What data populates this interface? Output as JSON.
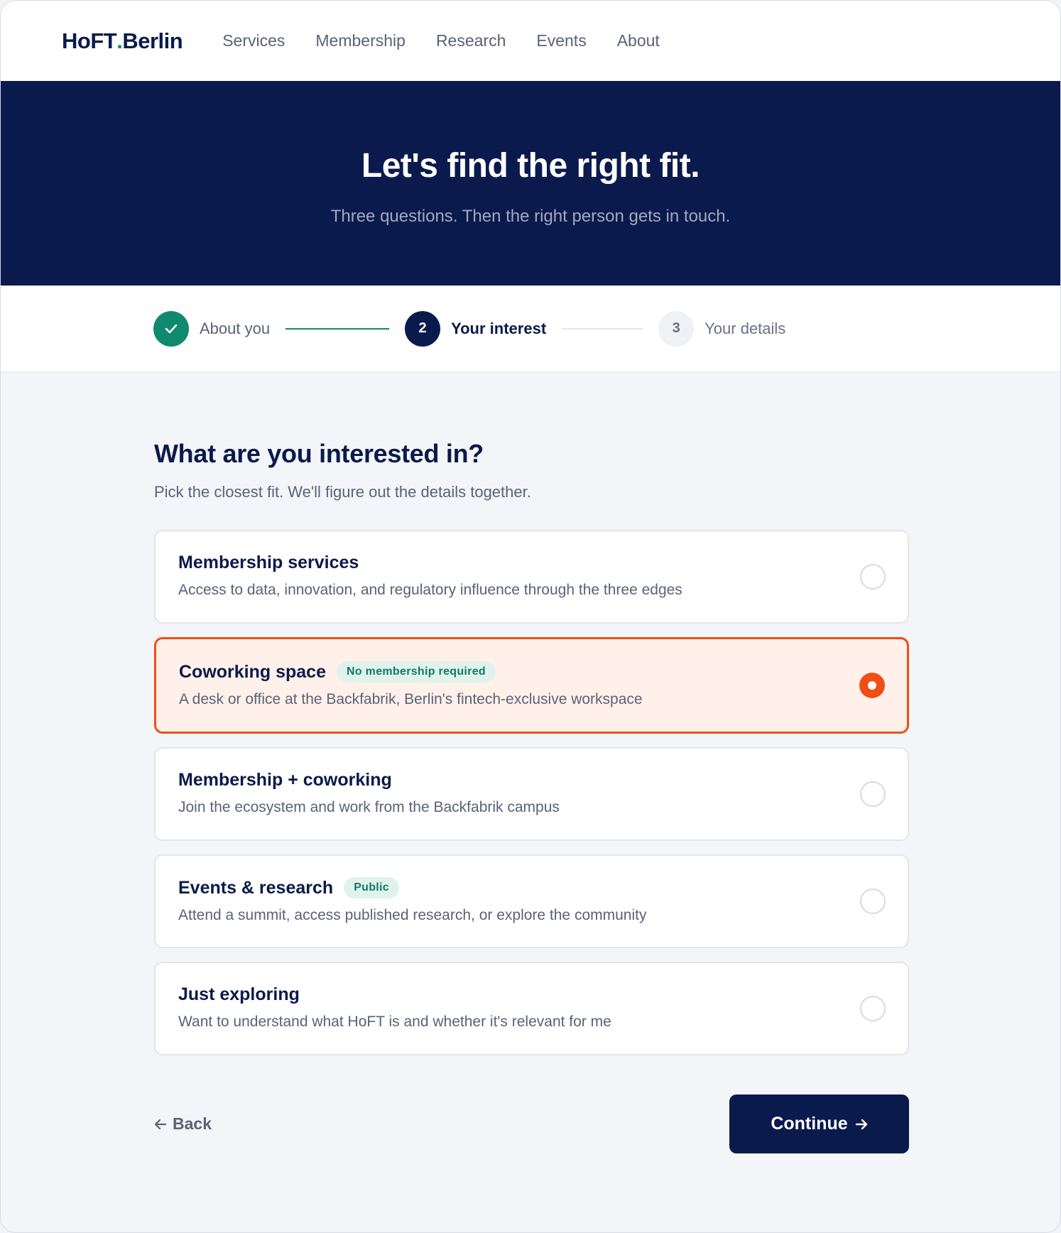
{
  "header": {
    "logo_main": "HoFT",
    "logo_dot": ".",
    "logo_suffix": "Berlin",
    "nav": [
      "Services",
      "Membership",
      "Research",
      "Events",
      "About"
    ]
  },
  "hero": {
    "title": "Let's find the right fit.",
    "subtitle": "Three questions. Then the right person gets in touch."
  },
  "stepper": {
    "steps": [
      {
        "number": "1",
        "label": "About you",
        "state": "done"
      },
      {
        "number": "2",
        "label": "Your interest",
        "state": "active"
      },
      {
        "number": "3",
        "label": "Your details",
        "state": "todo"
      }
    ]
  },
  "question": {
    "title": "What are you interested in?",
    "subtitle": "Pick the closest fit. We'll figure out the details together."
  },
  "options": [
    {
      "title": "Membership services",
      "badge": "",
      "desc": "Access to data, innovation, and regulatory influence through the three edges",
      "selected": false
    },
    {
      "title": "Coworking space",
      "badge": "No membership required",
      "desc": "A desk or office at the Backfabrik, Berlin's fintech-exclusive workspace",
      "selected": true
    },
    {
      "title": "Membership + coworking",
      "badge": "",
      "desc": "Join the ecosystem and work from the Backfabrik campus",
      "selected": false
    },
    {
      "title": "Events & research",
      "badge": "Public",
      "desc": "Attend a summit, access published research, or explore the community",
      "selected": false
    },
    {
      "title": "Just exploring",
      "badge": "",
      "desc": "Want to understand what HoFT is and whether it's relevant for me",
      "selected": false
    }
  ],
  "actions": {
    "back_label": "Back",
    "continue_label": "Continue"
  },
  "colors": {
    "navy": "#0b1a4d",
    "accent": "#f04e14",
    "green": "#0f8a6e"
  }
}
